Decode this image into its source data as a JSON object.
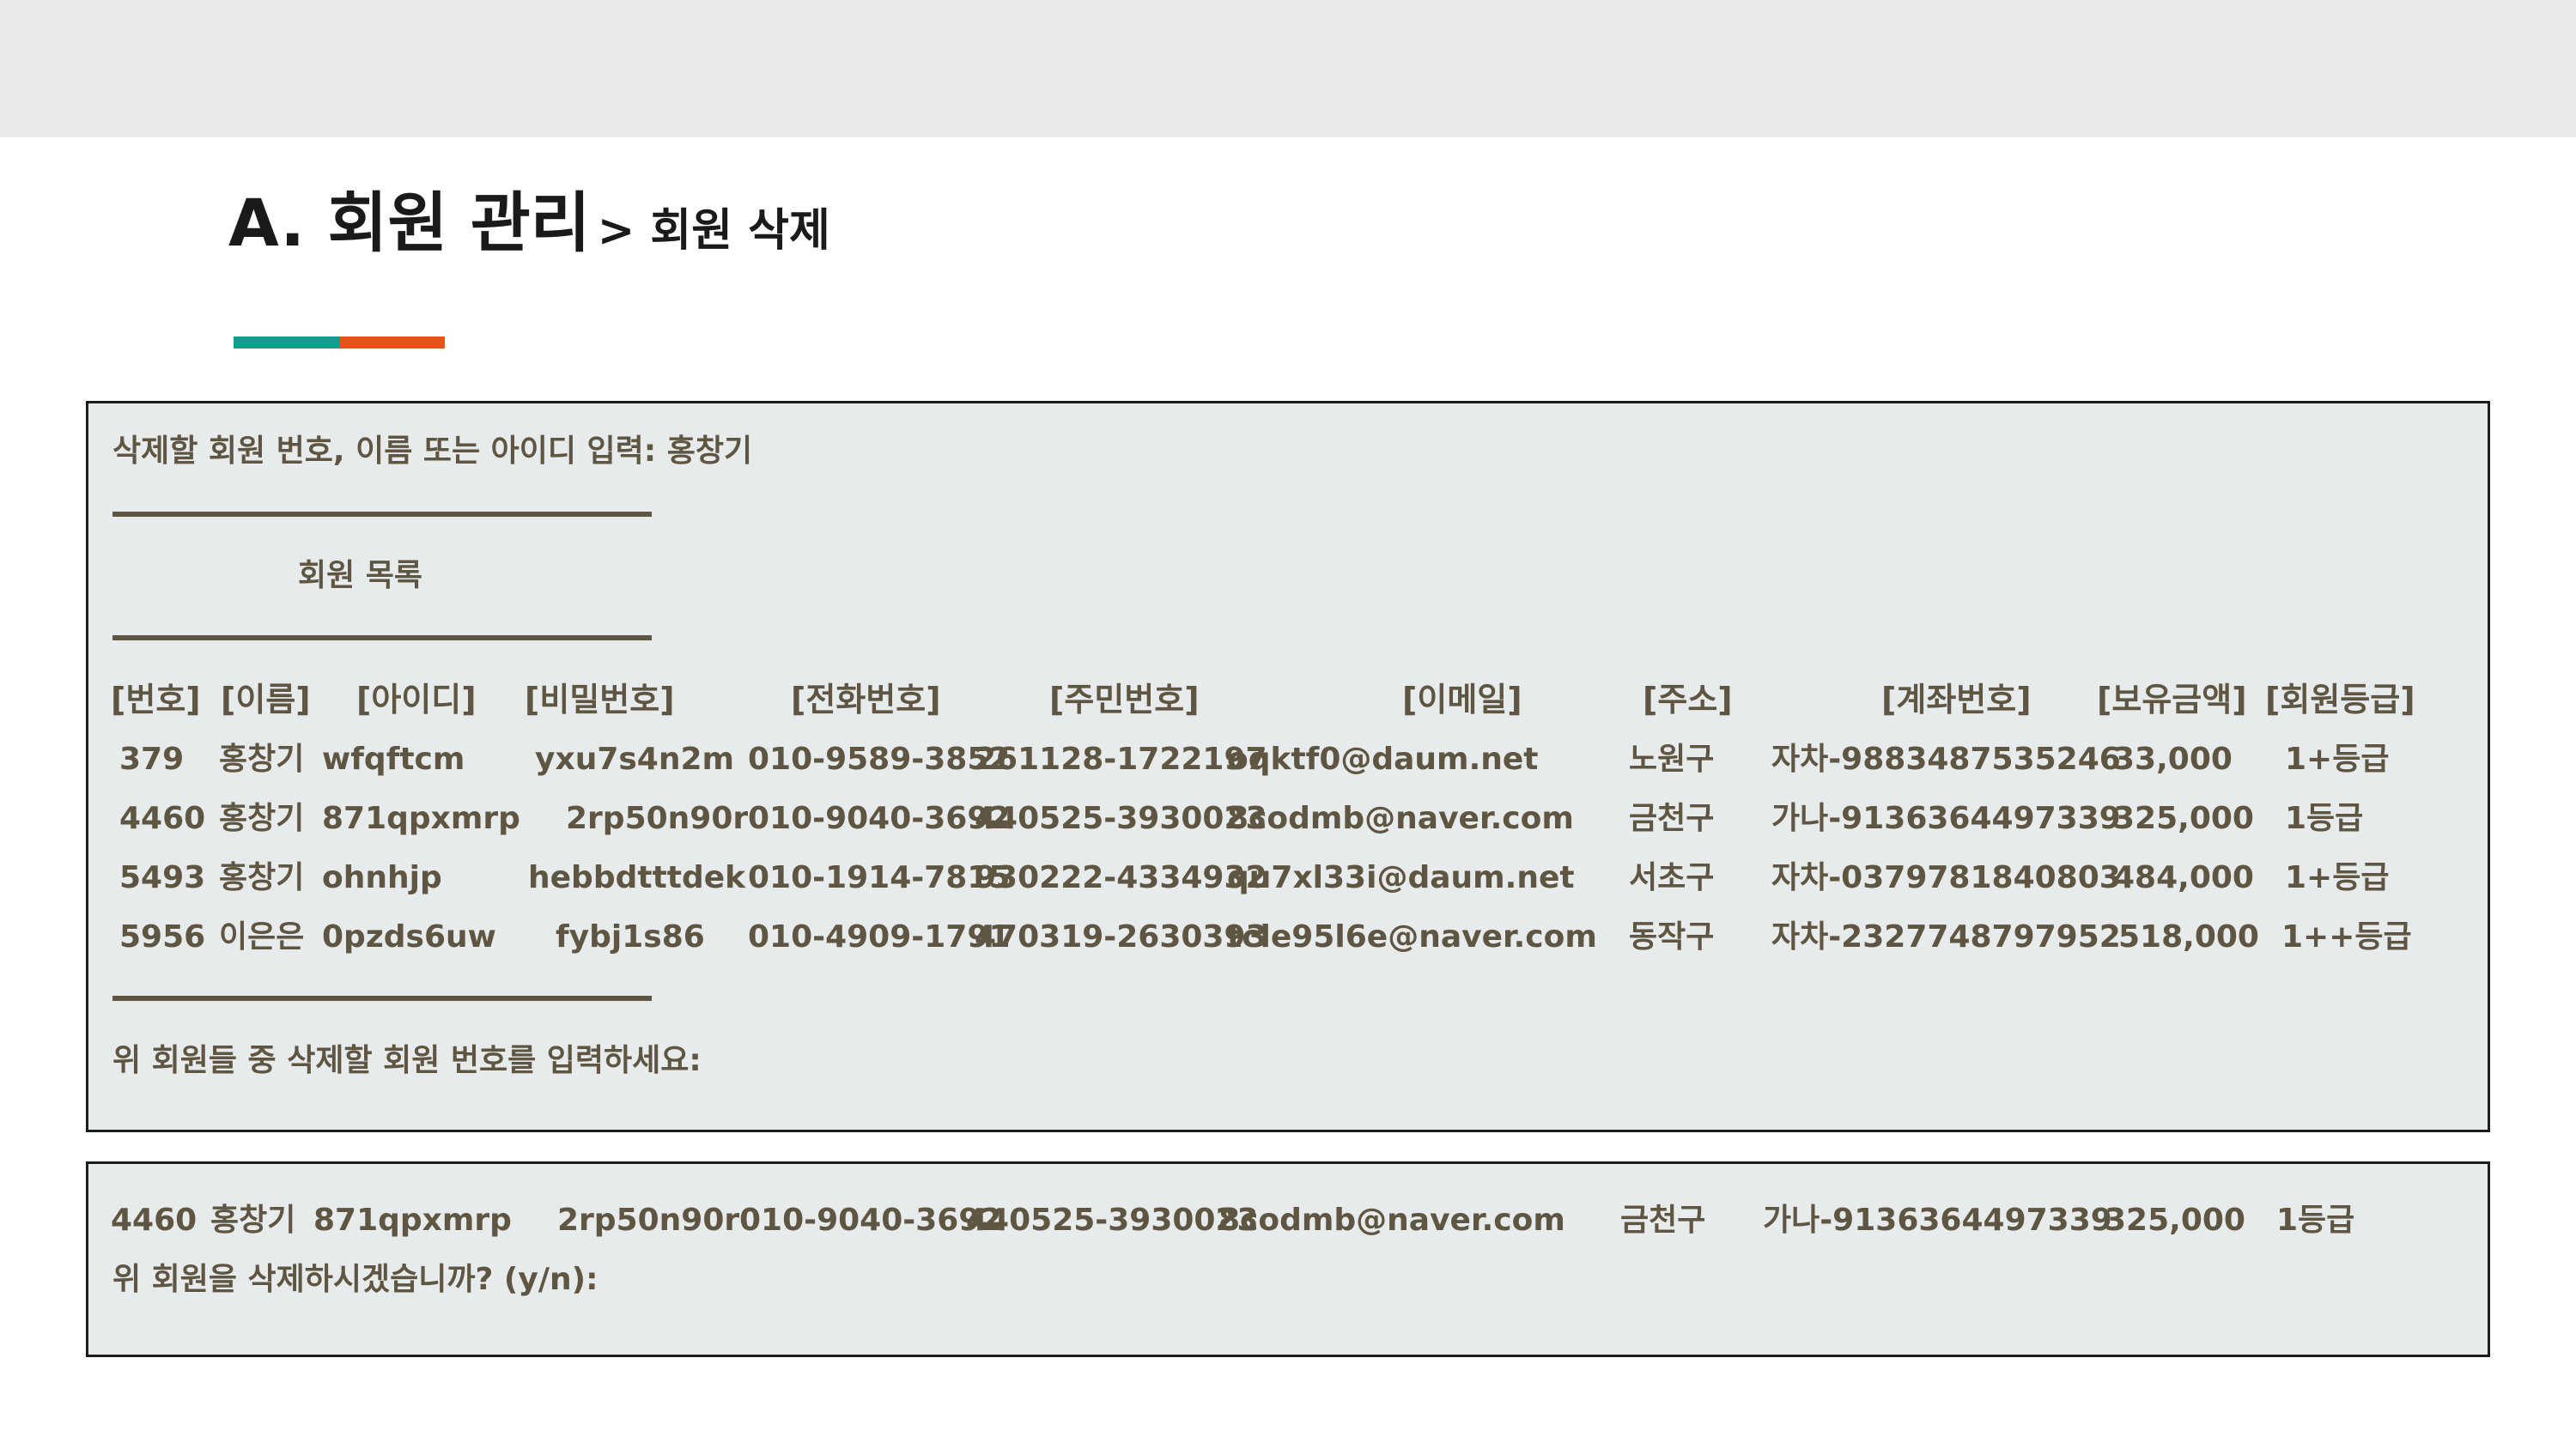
{
  "slide": {
    "title": "A. 회원 관리",
    "subtitle": "> 회원 삭제"
  },
  "console": {
    "prompt": "삭제할 회원 번호, 이름 또는 아이디 입력: 홍창기",
    "list_title": "회원 목록",
    "headers": [
      "[번호]",
      "[이름]",
      "[아이디]",
      "[비밀번호]",
      "[전화번호]",
      "[주민번호]",
      "[이메일]",
      "[주소]",
      "[계좌번호]",
      "[보유금액]",
      "[회원등급]"
    ],
    "rows": [
      [
        "379",
        "홍창기",
        "wfqftcm",
        "yxu7s4n2m",
        "010-9589-3852",
        "261128-1722197",
        "oqktf0@daum.net",
        "노원구",
        "자차-9883487535246",
        "33,000",
        "1+등급"
      ],
      [
        "4460",
        "홍창기",
        "871qpxmrp",
        "2rp50n90r",
        "010-9040-3692",
        "440525-3930023",
        "8codmb@naver.com",
        "금천구",
        "가나-9136364497339",
        "325,000",
        "1등급"
      ],
      [
        "5493",
        "홍창기",
        "ohnhjp",
        "hebbdtttdek",
        "010-1914-7815",
        "930222-4334932",
        "qu7xl33i@daum.net",
        "서초구",
        "자차-0379781840803",
        "484,000",
        "1+등급"
      ],
      [
        "5956",
        "이은은",
        "0pzds6uw",
        "fybj1s86",
        "010-4909-1791",
        "470319-2630393",
        "tcle95l6e@naver.com",
        "동작구",
        "자차-2327748797952",
        "518,000",
        "1++등급"
      ]
    ],
    "select_prompt": "위 회원들 중 삭제할 회원 번호를 입력하세요:"
  },
  "confirm": {
    "selected": [
      "4460",
      "홍창기",
      "871qpxmrp",
      "2rp50n90r",
      "010-9040-3692",
      "440525-3930023",
      "8codmb@naver.com",
      "금천구",
      "가나-9136364497339",
      "325,000",
      "1등급"
    ],
    "question": "위 회원을 삭제하시겠습니까? (y/n):"
  },
  "colors": {
    "console_text": "#5e5642",
    "console_bg": "#e8ebec",
    "accent_teal": "#169b8f",
    "accent_orange": "#e2541a"
  }
}
